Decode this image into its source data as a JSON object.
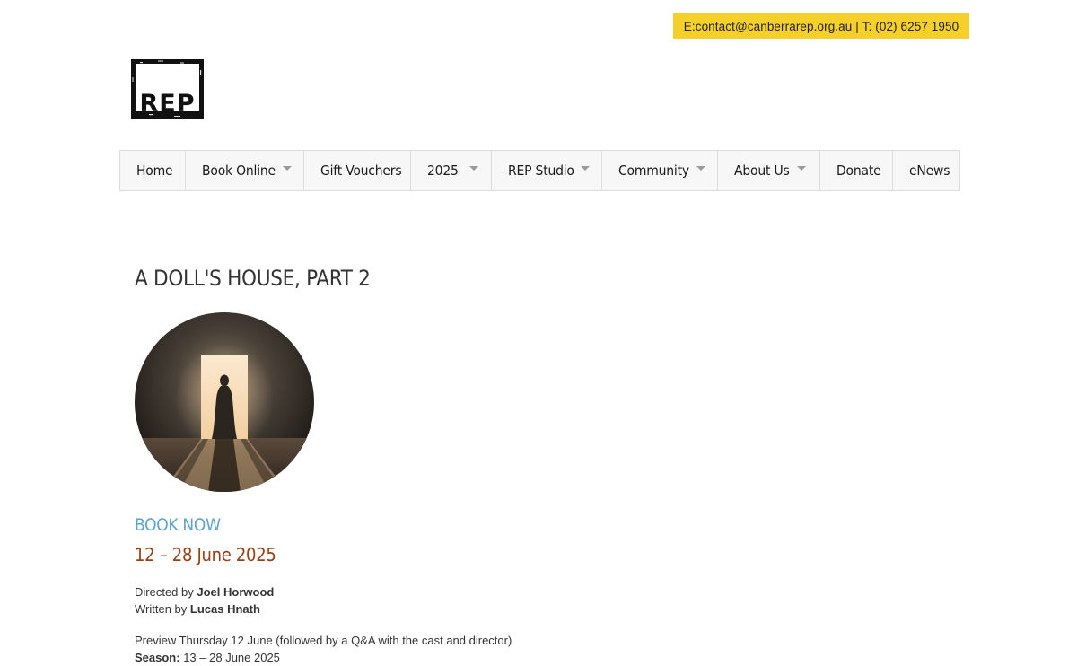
{
  "contact": {
    "email_label": "E: ",
    "email": "contact@canberrarep.org.au",
    "separator": " | ",
    "phone_label": "T: ",
    "phone": "(02) 6257 1950"
  },
  "logo": {
    "text": "REP"
  },
  "nav": {
    "items": [
      {
        "label": "Home",
        "dropdown": false
      },
      {
        "label": "Book Online",
        "dropdown": true
      },
      {
        "label": "Gift Vouchers",
        "dropdown": false
      },
      {
        "label": "2025",
        "dropdown": true
      },
      {
        "label": "REP Studio",
        "dropdown": true
      },
      {
        "label": "Community",
        "dropdown": true
      },
      {
        "label": "About Us",
        "dropdown": true
      },
      {
        "label": "Donate",
        "dropdown": false
      },
      {
        "label": "eNews",
        "dropdown": false
      }
    ]
  },
  "show": {
    "title": "A DOLL'S HOUSE, PART 2",
    "book_now": "BOOK NOW",
    "dates": "12 – 28 June 2025",
    "directed_prefix": "Directed by ",
    "director": "Joel Horwood",
    "written_prefix": "Written by ",
    "writer": "Lucas Hnath",
    "preview": "Preview Thursday 12 June (followed by a Q&A with the cast and director)",
    "season_label": "Season:",
    "season_dates": "13 – 28 June 2025"
  },
  "colors": {
    "contact_bg": "#f6d02a",
    "book_now": "#5fa3c9",
    "dates": "#9a3f12"
  }
}
